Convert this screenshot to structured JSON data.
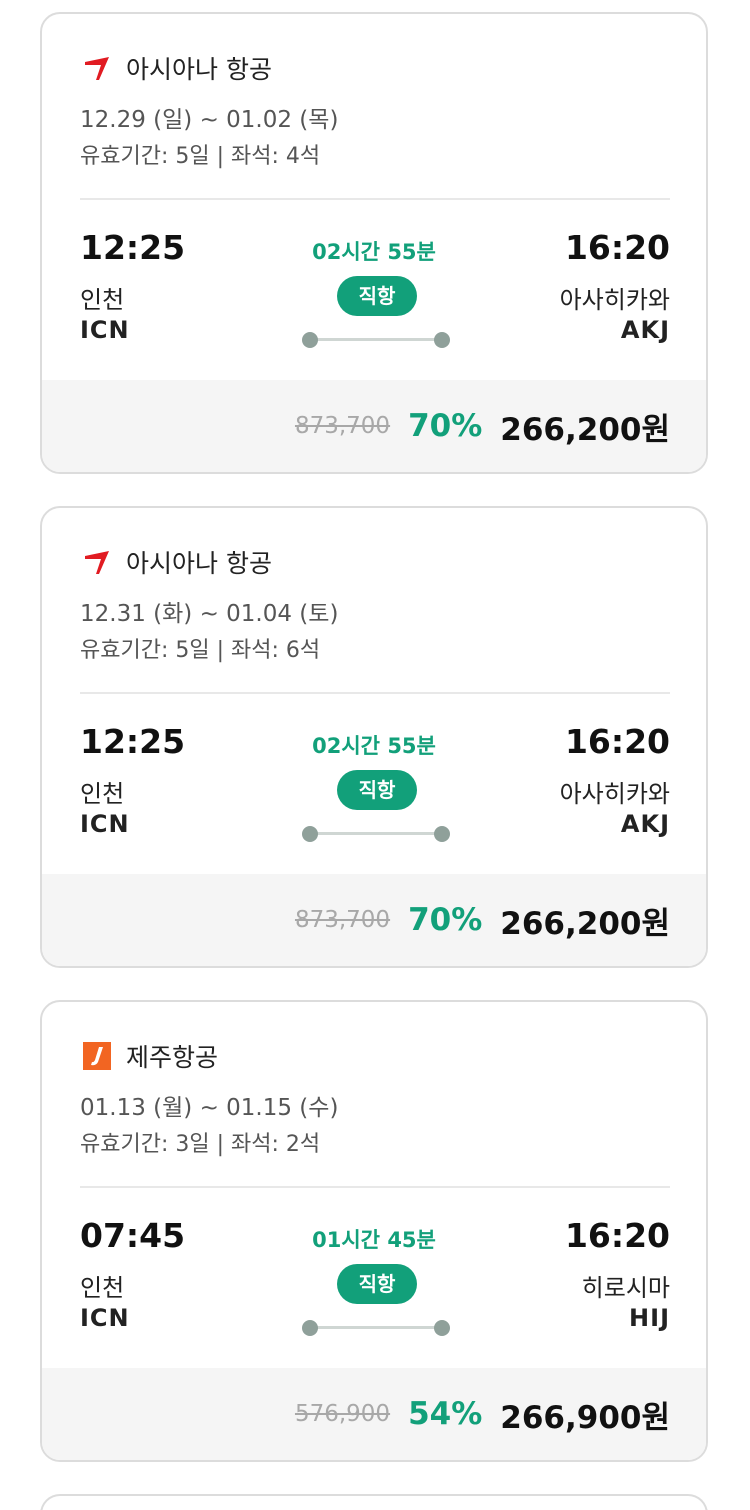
{
  "colors": {
    "accent_green": "#12a07a",
    "asiana_red": "#e11b22",
    "jeju_orange": "#f26522"
  },
  "flights": [
    {
      "airline": "아시아나 항공",
      "logo_icon": "asiana-logo-icon",
      "dates": "12.29 (일) ~ 01.02 (목)",
      "validity": "유효기간: 5일 | 좌석: 4석",
      "dep_time": "12:25",
      "dep_city": "인천",
      "dep_code": "ICN",
      "duration": "02시간 55분",
      "direct_label": "직항",
      "arr_time": "16:20",
      "arr_city": "아사히카와",
      "arr_code": "AKJ",
      "original_price": "873,700",
      "discount": "70%",
      "final_price": "266,200원"
    },
    {
      "airline": "아시아나 항공",
      "logo_icon": "asiana-logo-icon",
      "dates": "12.31 (화) ~ 01.04 (토)",
      "validity": "유효기간: 5일 | 좌석: 6석",
      "dep_time": "12:25",
      "dep_city": "인천",
      "dep_code": "ICN",
      "duration": "02시간 55분",
      "direct_label": "직항",
      "arr_time": "16:20",
      "arr_city": "아사히카와",
      "arr_code": "AKJ",
      "original_price": "873,700",
      "discount": "70%",
      "final_price": "266,200원"
    },
    {
      "airline": "제주항공",
      "logo_icon": "jejuair-logo-icon",
      "dates": "01.13 (월) ~ 01.15 (수)",
      "validity": "유효기간: 3일 | 좌석: 2석",
      "dep_time": "07:45",
      "dep_city": "인천",
      "dep_code": "ICN",
      "duration": "01시간 45분",
      "direct_label": "직항",
      "arr_time": "16:20",
      "arr_city": "히로시마",
      "arr_code": "HIJ",
      "original_price": "576,900",
      "discount": "54%",
      "final_price": "266,900원"
    }
  ]
}
